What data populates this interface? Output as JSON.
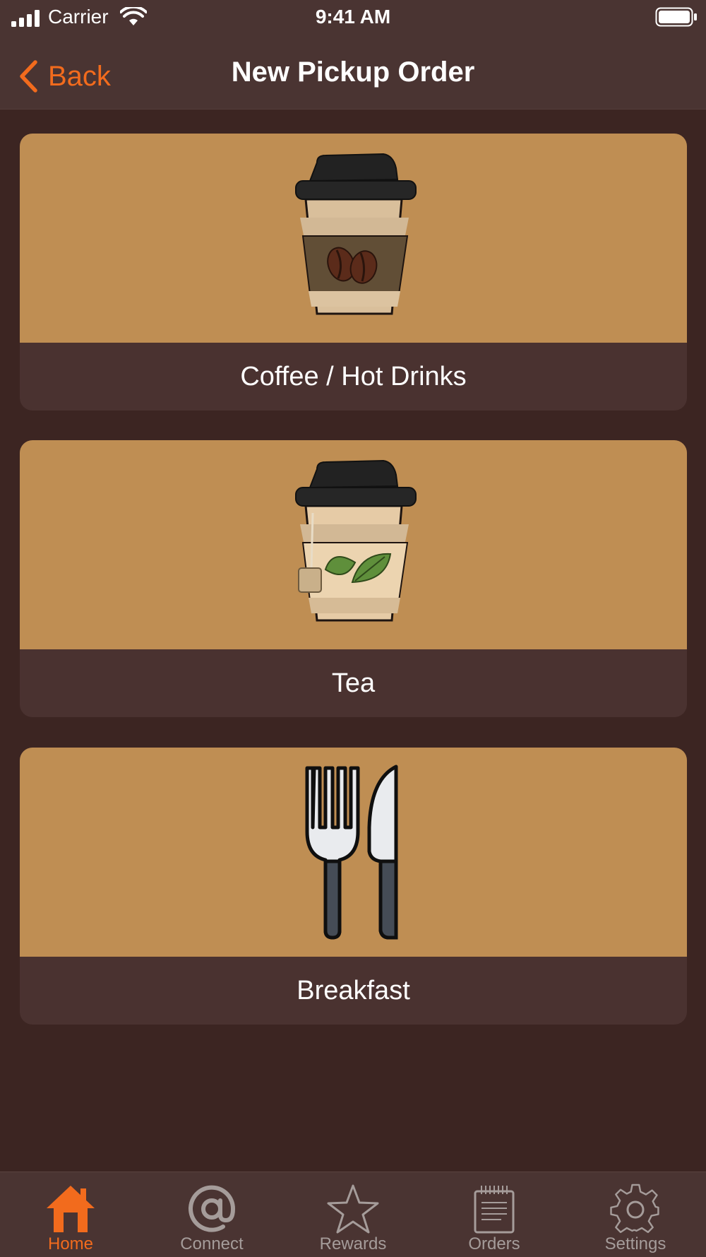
{
  "status_bar": {
    "carrier": "Carrier",
    "time": "9:41 AM",
    "icons": [
      "signal-icon",
      "wifi-icon",
      "battery-icon"
    ]
  },
  "nav": {
    "back_label": "Back",
    "title": "New Pickup Order"
  },
  "categories": [
    {
      "label": "Coffee / Hot Drinks",
      "icon": "coffee-cup-icon"
    },
    {
      "label": "Tea",
      "icon": "tea-cup-icon"
    },
    {
      "label": "Breakfast",
      "icon": "fork-knife-icon"
    }
  ],
  "tabs": [
    {
      "label": "Home",
      "icon": "home-icon",
      "active": true
    },
    {
      "label": "Connect",
      "icon": "at-sign-icon",
      "active": false
    },
    {
      "label": "Rewards",
      "icon": "star-icon",
      "active": false
    },
    {
      "label": "Orders",
      "icon": "notepad-icon",
      "active": false
    },
    {
      "label": "Settings",
      "icon": "gear-icon",
      "active": false
    }
  ],
  "colors": {
    "background": "#3c2522",
    "bar": "#4a3432",
    "card_art": "#bf8e53",
    "card_label": "#4a3230",
    "accent": "#f26b1d"
  }
}
